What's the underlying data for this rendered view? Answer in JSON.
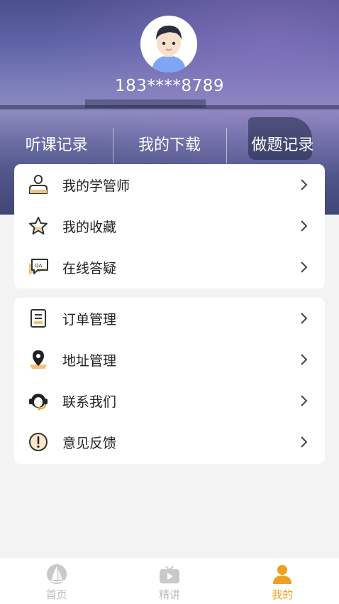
{
  "profile": {
    "phone": "183****8789"
  },
  "header_tabs": [
    {
      "label": "听课记录"
    },
    {
      "label": "我的下载"
    },
    {
      "label": "做题记录"
    }
  ],
  "menu_group_1": [
    {
      "label": "我的学管师",
      "icon": "teacher-icon"
    },
    {
      "label": "我的收藏",
      "icon": "star-icon"
    },
    {
      "label": "在线答疑",
      "icon": "qa-chat-icon"
    }
  ],
  "menu_group_2": [
    {
      "label": "订单管理",
      "icon": "document-icon"
    },
    {
      "label": "地址管理",
      "icon": "location-pin-icon"
    },
    {
      "label": "联系我们",
      "icon": "headset-icon"
    },
    {
      "label": "意见反馈",
      "icon": "exclamation-icon"
    }
  ],
  "bottom_nav": [
    {
      "label": "首页",
      "icon": "sail-logo-icon"
    },
    {
      "label": "精讲",
      "icon": "tv-play-icon"
    },
    {
      "label": "我的",
      "icon": "person-icon",
      "active": true
    }
  ],
  "colors": {
    "accent": "#f0a020",
    "inactive": "#bbbbbb"
  }
}
